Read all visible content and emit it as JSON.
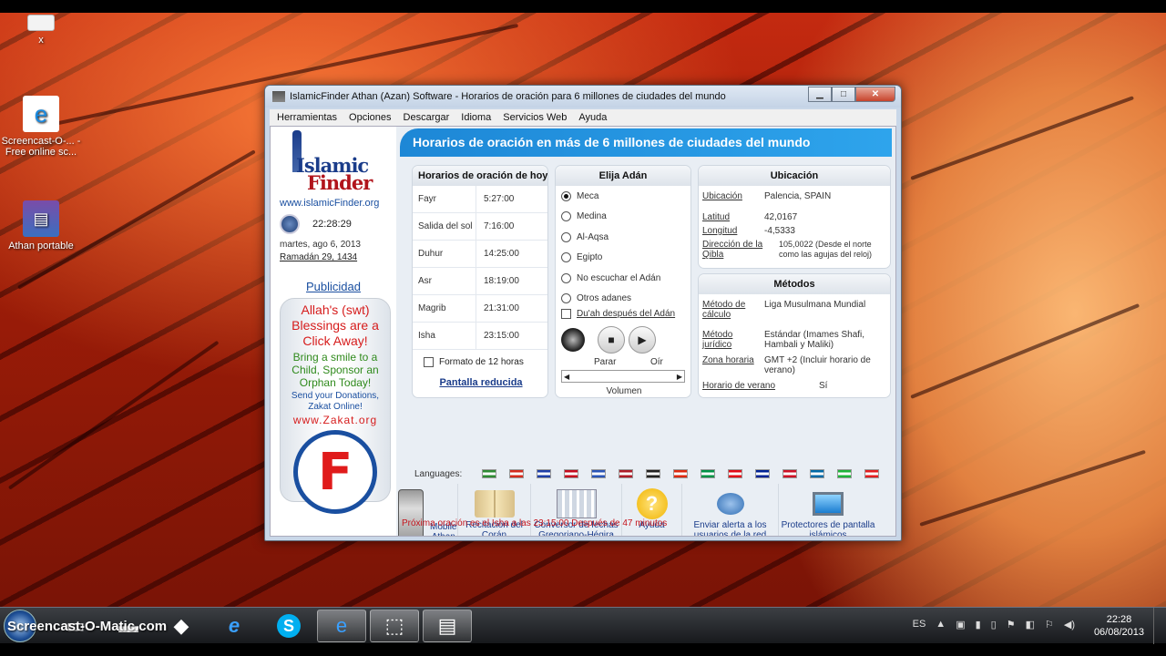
{
  "desktop": {
    "icons": [
      {
        "label": "x"
      },
      {
        "label": "Screencast-O-... - Free online sc..."
      },
      {
        "label": "Athan portable"
      }
    ]
  },
  "window": {
    "title": "IslamicFinder Athan (Azan) Software - Horarios de oración para 6 millones de ciudades del mundo",
    "menu": [
      "Herramientas",
      "Opciones",
      "Descargar",
      "Idioma",
      "Servicios Web",
      "Ayuda"
    ],
    "logo_line1": "Islamic",
    "logo_line2": "Finder",
    "site_url": "www.islamicFinder.org",
    "time": "22:28:29",
    "date": "martes, ago 6, 2013",
    "hijri_date": "Ramadán 29, 1434",
    "publicidad": "Publicidad",
    "ad": {
      "line1": "Allah's (swt) Blessings are a Click Away!",
      "line2": "Bring a smile to a Child, Sponsor an Orphan Today!",
      "line3": "Send your Donations, Zakat Online!",
      "line4": "www.Zakat.org"
    },
    "banner": "Horarios de oración en más de 6 millones de ciudades del mundo",
    "prayer_panel": {
      "title": "Horarios de oración de hoy",
      "rows": [
        {
          "name": "Fayr",
          "time": "5:27:00"
        },
        {
          "name": "Salida del sol",
          "time": "7:16:00"
        },
        {
          "name": "Duhur",
          "time": "14:25:00"
        },
        {
          "name": "Asr",
          "time": "18:19:00"
        },
        {
          "name": "Magrib",
          "time": "21:31:00"
        },
        {
          "name": "Isha",
          "time": "23:15:00"
        }
      ],
      "format12": "Formato de 12 horas",
      "reduced": "Pantalla reducida"
    },
    "adhan_panel": {
      "title": "Elija Adán",
      "options": [
        "Meca",
        "Medina",
        "Al-Aqsa",
        "Egipto",
        "No escuchar el Adán",
        "Otros adanes"
      ],
      "selected": "Meca",
      "dua": "Du'ah después del Adán",
      "stop_label": "Parar",
      "listen_label": "Oír",
      "volume_label": "Volumen"
    },
    "location_panel": {
      "title": "Ubicación",
      "fields": [
        {
          "k": "Ubicación",
          "v": "Palencia, SPAIN"
        },
        {
          "k": "Latitud",
          "v": "42,0167"
        },
        {
          "k": "Longitud",
          "v": "-4,5333"
        },
        {
          "k": "Dirección de la Qibla",
          "v": "105,0022 (Desde el norte como las agujas del reloj)"
        }
      ]
    },
    "methods_panel": {
      "title": "Métodos",
      "fields": [
        {
          "k": "Método de cálculo",
          "v": "Liga Musulmana Mundial"
        },
        {
          "k": "Método jurídico",
          "v": "Estándar (Imames Shafi, Hambali y Maliki)"
        },
        {
          "k": "Zona horaria",
          "v": "GMT +2 (Incluir horario de verano)"
        },
        {
          "k": "Horario de verano",
          "v": "Sí"
        }
      ]
    },
    "languages_label": "Languages:",
    "flag_colors": [
      "#2e8b34",
      "#d52b1e",
      "#1f3fa8",
      "#c60b1e",
      "#2a55b8",
      "#ae1c28",
      "#222222",
      "#de2910",
      "#009246",
      "#e30a17",
      "#002395",
      "#ce1126",
      "#006aa7",
      "#1eb53a",
      "#e41e20"
    ],
    "shortcuts": [
      {
        "label": "Mobile Athan",
        "icon": "phone-icon"
      },
      {
        "label": "Recitación del Corán",
        "icon": "quran-book-icon"
      },
      {
        "label": "Conversor de fechas Gregoriano-Hégira",
        "icon": "calendar-icon"
      },
      {
        "label": "Ayuda",
        "icon": "help-icon"
      },
      {
        "label": "Enviar alerta a los usuarios de la red",
        "icon": "network-users-icon"
      },
      {
        "label": "Protectores de pantalla islámicos",
        "icon": "monitor-icon"
      }
    ],
    "next_prayer": "Próxima oración es el Isha a las 23:15:00 Después de 47 minutos"
  },
  "taskbar": {
    "brand": "Screencast-O-Matic.com",
    "lang": "ES",
    "clock_time": "22:28",
    "clock_date": "06/08/2013"
  }
}
